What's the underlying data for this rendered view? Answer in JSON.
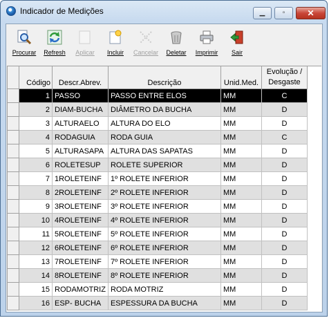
{
  "window": {
    "title": "Indicador de Medições"
  },
  "toolbar": [
    {
      "label": "Procurar",
      "icon": "search-icon",
      "enabled": true
    },
    {
      "label": "Refresh",
      "icon": "refresh-icon",
      "enabled": true
    },
    {
      "label": "Aplicar",
      "icon": "apply-icon",
      "enabled": false
    },
    {
      "label": "Incluir",
      "icon": "new-document-icon",
      "enabled": true
    },
    {
      "label": "Cancelar",
      "icon": "cancel-icon",
      "enabled": false
    },
    {
      "label": "Deletar",
      "icon": "trash-icon",
      "enabled": true
    },
    {
      "label": "Imprimir",
      "icon": "printer-icon",
      "enabled": true
    },
    {
      "label": "Sair",
      "icon": "exit-icon",
      "enabled": true
    }
  ],
  "grid": {
    "columns": [
      "Código",
      "Descr.Abrev.",
      "Descrição",
      "Unid.Med.",
      "Evolução / Desgaste"
    ],
    "rows": [
      [
        "1",
        "PASSO",
        "PASSO ENTRE ELOS",
        "MM",
        "C"
      ],
      [
        "2",
        "DIAM-BUCHA",
        "DIÂMETRO DA BUCHA",
        "MM",
        "D"
      ],
      [
        "3",
        "ALTURAELO",
        "ALTURA DO ELO",
        "MM",
        "D"
      ],
      [
        "4",
        "RODAGUIA",
        "RODA GUIA",
        "MM",
        "C"
      ],
      [
        "5",
        "ALTURASAPA",
        "ALTURA DAS SAPATAS",
        "MM",
        "D"
      ],
      [
        "6",
        "ROLETESUP",
        "ROLETE SUPERIOR",
        "MM",
        "D"
      ],
      [
        "7",
        "1ROLETEINF",
        "1º ROLETE INFERIOR",
        "MM",
        "D"
      ],
      [
        "8",
        "2ROLETEINF",
        "2º ROLETE INFERIOR",
        "MM",
        "D"
      ],
      [
        "9",
        "3ROLETEINF",
        "3º ROLETE INFERIOR",
        "MM",
        "D"
      ],
      [
        "10",
        "4ROLETEINF",
        "4º ROLETE INFERIOR",
        "MM",
        "D"
      ],
      [
        "11",
        "5ROLETEINF",
        "5º ROLETE INFERIOR",
        "MM",
        "D"
      ],
      [
        "12",
        "6ROLETEINF",
        "6º ROLETE INFERIOR",
        "MM",
        "D"
      ],
      [
        "13",
        "7ROLETEINF",
        "7º ROLETE INFERIOR",
        "MM",
        "D"
      ],
      [
        "14",
        "8ROLETEINF",
        "8º ROLETE INFERIOR",
        "MM",
        "D"
      ],
      [
        "15",
        "RODAMOTRIZ",
        "RODA MOTRIZ",
        "MM",
        "D"
      ],
      [
        "16",
        "ESP- BUCHA",
        "ESPESSURA DA BUCHA",
        "MM",
        "D"
      ]
    ],
    "selected_row": 0
  }
}
